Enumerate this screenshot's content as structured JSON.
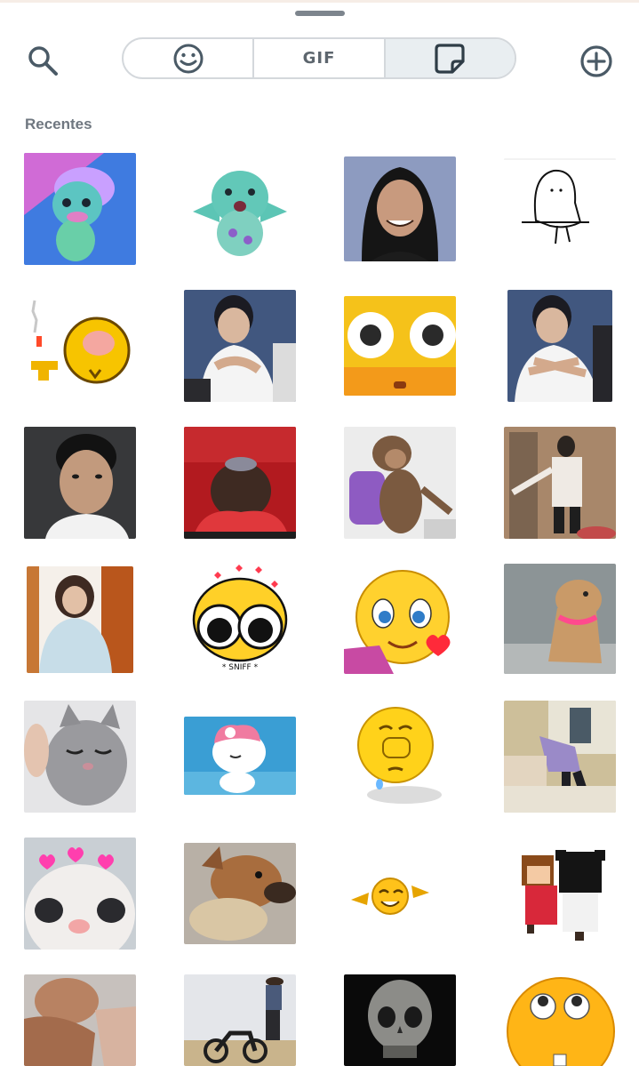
{
  "toolbar": {
    "search_icon": "search-icon",
    "add_icon": "add-icon",
    "tabs": [
      {
        "name": "emoji",
        "icon": "smiley-icon",
        "active": false
      },
      {
        "name": "gif",
        "label": "GIF",
        "active": false
      },
      {
        "name": "stickers",
        "icon": "sticker-icon",
        "active": true
      }
    ]
  },
  "section": {
    "title": "Recentes"
  },
  "colors": {
    "handle": "#7d858d",
    "tab_border": "#d4d8dc",
    "active_tab": "#e9eef1",
    "section_text": "#6f7780",
    "icon": "#4a5a66"
  },
  "stickers": [
    "turquoise-troll-sticker",
    "turquoise-troll-arms-sticker",
    "woman-smiling-sticker",
    "doodle-ghost-sticker",
    "pixel-emoji-smoking-sticker",
    "boy-hugging-sticker",
    "blushing-emoji-closeup-sticker",
    "boy-crossed-arms-sticker",
    "boy-selfie-sticker",
    "girl-face-down-sticker",
    "monkey-backpack-sticker",
    "man-pointing-sticker",
    "girl-white-sweater-sticker",
    "crying-emoji-sniff-sticker",
    "flirty-emoji-laptop-sticker",
    "dog-pink-collar-sticker",
    "cat-smug-sticker",
    "pink-bunny-sticker",
    "praying-emoji-sticker",
    "man-bending-sticker",
    "cat-hearts-sticker",
    "dog-hugging-sticker",
    "emoji-pointing-sticker",
    "pixel-couple-sticker",
    "man-hands-sticker",
    "man-motorcycle-sticker",
    "skull-sticker",
    "rolling-eyes-emoji-sticker"
  ]
}
